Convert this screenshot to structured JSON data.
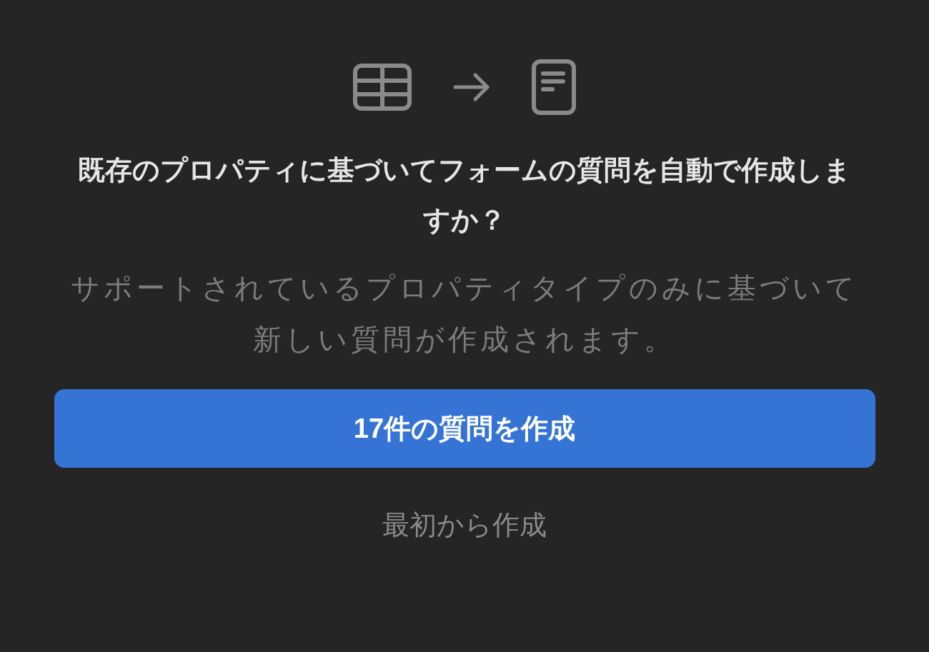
{
  "dialog": {
    "title": "既存のプロパティに基づいてフォームの質問を自動で作成しますか？",
    "description": "サポートされているプロパティタイプのみに基づいて新しい質問が作成されます。",
    "primary_button": "17件の質問を作成",
    "secondary_link": "最初から作成"
  }
}
